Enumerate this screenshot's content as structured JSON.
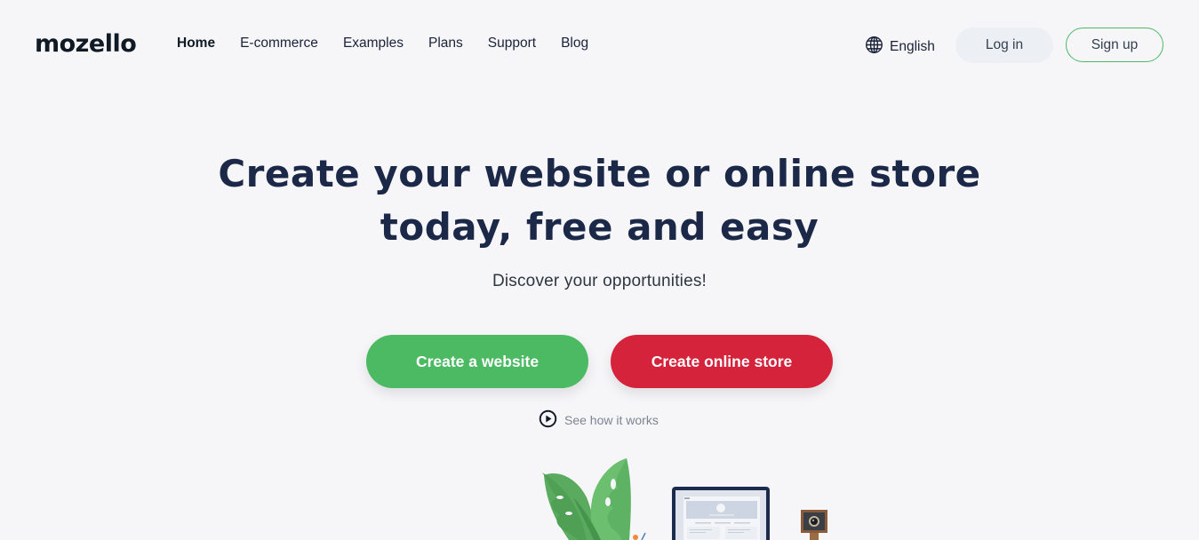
{
  "brand": {
    "logo_text": "mozello",
    "colors": {
      "primary_green": "#4cb963",
      "primary_red": "#d6233c",
      "heading": "#1b2848",
      "background": "#f6f6f9"
    }
  },
  "nav": {
    "items": [
      {
        "label": "Home",
        "active": true
      },
      {
        "label": "E-commerce",
        "active": false
      },
      {
        "label": "Examples",
        "active": false
      },
      {
        "label": "Plans",
        "active": false
      },
      {
        "label": "Support",
        "active": false
      },
      {
        "label": "Blog",
        "active": false
      }
    ]
  },
  "header_actions": {
    "language_icon": "globe-icon",
    "language_label": "English",
    "login_label": "Log in",
    "signup_label": "Sign up"
  },
  "hero": {
    "title_line1": "Create your website or online store",
    "title_line2": "today, free and easy",
    "subtitle": "Discover your opportunities!",
    "cta_primary": "Create a website",
    "cta_secondary": "Create online store",
    "how_icon": "play-circle-icon",
    "how_label": "See how it works"
  },
  "illustration": {
    "elements": [
      "monstera-plant",
      "pencil-cup",
      "laptop-with-website-mockup",
      "vintage-camera"
    ]
  }
}
